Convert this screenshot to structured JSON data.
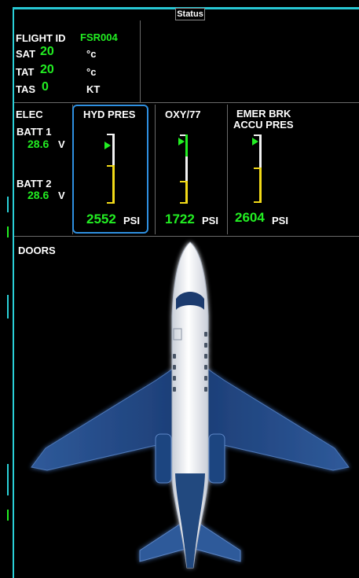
{
  "window": {
    "title": "Status"
  },
  "flight_info": {
    "flight_id_label": "FLIGHT ID",
    "flight_id_value": "FSR004",
    "sat_label": "SAT",
    "sat_value": "20",
    "sat_unit": "°c",
    "tat_label": "TAT",
    "tat_value": "20",
    "tat_unit": "°c",
    "tas_label": "TAS",
    "tas_value": "0",
    "tas_unit": "KT"
  },
  "elec": {
    "title": "ELEC",
    "batt1_label": "BATT 1",
    "batt1_value": "28.6",
    "batt1_unit": "V",
    "batt2_label": "BATT 2",
    "batt2_value": "28.6",
    "batt2_unit": "V"
  },
  "hyd": {
    "title": "HYD PRES",
    "value": "2552",
    "unit": "PSI"
  },
  "oxy": {
    "title": "OXY/77",
    "value": "1722",
    "unit": "PSI"
  },
  "emer": {
    "title_line1": "EMER BRK",
    "title_line2": "ACCU PRES",
    "value": "2604",
    "unit": "PSI"
  },
  "doors": {
    "title": "DOORS"
  },
  "colors": {
    "accent": "#2ad0d8",
    "value_green": "#22ee22",
    "gauge_yellow": "#f2da18",
    "highlight_blue": "#2e8fe0"
  }
}
